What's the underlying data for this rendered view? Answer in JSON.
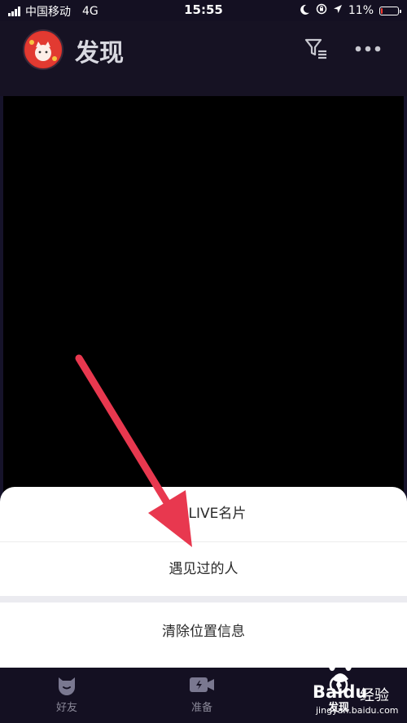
{
  "status_bar": {
    "carrier": "中国移动",
    "network": "4G",
    "time": "15:55",
    "battery_percent": "11%",
    "battery_level": 0.11
  },
  "header": {
    "title": "发现"
  },
  "action_sheet": {
    "items": [
      {
        "label": "我的LIVE名片"
      },
      {
        "label": "遇见过的人"
      },
      {
        "label": "清除位置信息"
      }
    ]
  },
  "tab_bar": {
    "tabs": [
      {
        "label": "好友"
      },
      {
        "label": "准备"
      },
      {
        "label": "发现"
      }
    ]
  },
  "watermark": {
    "brand": "Baidu",
    "brand_cn": "经验",
    "url": "jingyan.baidu.com"
  },
  "colors": {
    "background": "#16132a",
    "annotation_arrow": "#e8384f",
    "battery_low": "#ff3b30"
  }
}
